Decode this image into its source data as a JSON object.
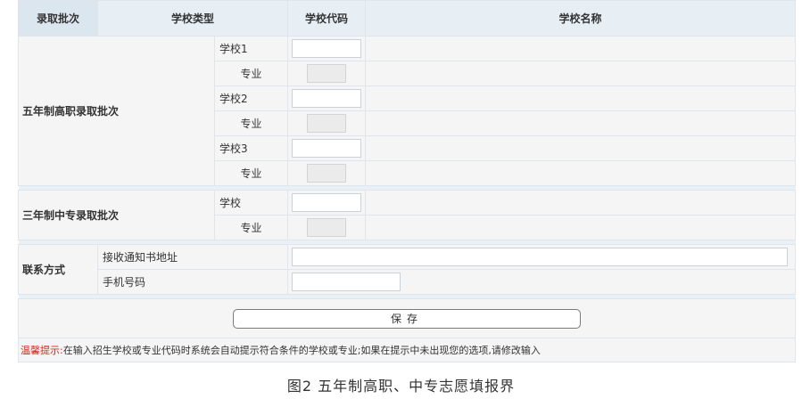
{
  "header": {
    "batch": "录取批次",
    "school_type": "学校类型",
    "school_code": "学校代码",
    "school_name": "学校名称"
  },
  "five_year": {
    "title": "五年制高职录取批次",
    "rows": [
      {
        "label": "学校1",
        "kind": "school"
      },
      {
        "label": "专业",
        "kind": "major"
      },
      {
        "label": "学校2",
        "kind": "school"
      },
      {
        "label": "专业",
        "kind": "major"
      },
      {
        "label": "学校3",
        "kind": "school"
      },
      {
        "label": "专业",
        "kind": "major"
      }
    ]
  },
  "three_year": {
    "title": "三年制中专录取批次",
    "school_label": "学校",
    "major_label": "专业"
  },
  "contact": {
    "title": "联系方式",
    "address_label": "接收通知书地址",
    "phone_label": "手机号码"
  },
  "save_label": "保存",
  "tip": {
    "label": "温馨提示:",
    "text": "在输入招生学校或专业代码时系统会自动提示符合条件的学校或专业;如果在提示中未出现您的选项,请修改输入"
  },
  "caption": "图2  五年制高职、中专志愿填报界"
}
